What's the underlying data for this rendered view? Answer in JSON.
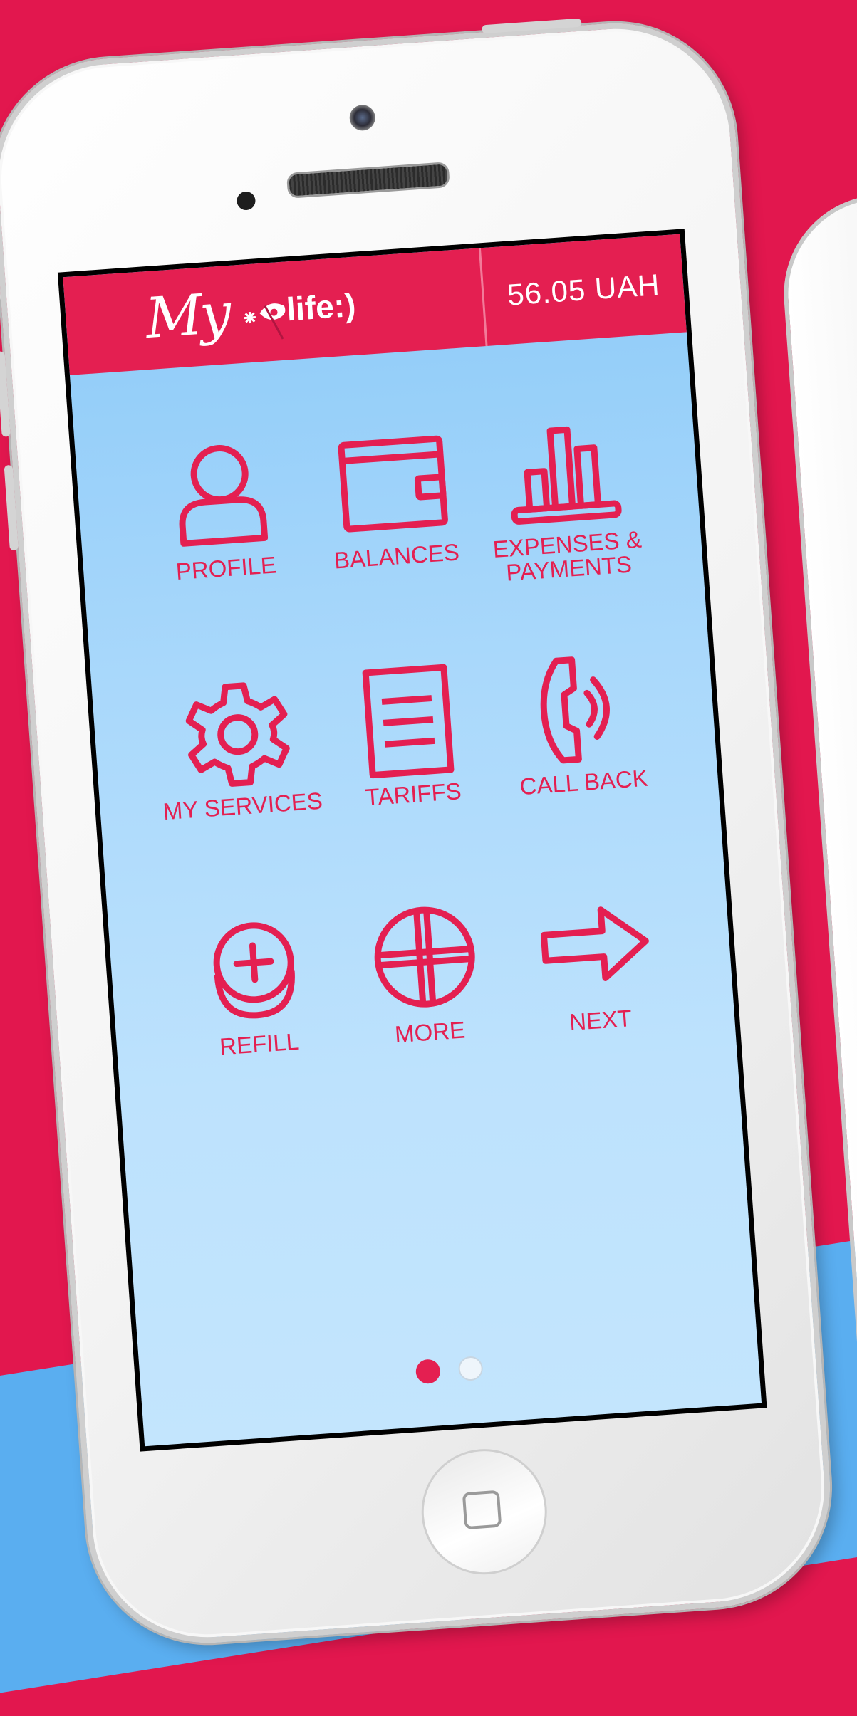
{
  "app": {
    "logo_prefix": "My",
    "logo_brand": "life:)",
    "balance": "56.05 UAH"
  },
  "menu": {
    "profile": "PROFILE",
    "balances": "BALANCES",
    "expenses": "EXPENSES &\nPAYMENTS",
    "services": "MY SERVICES",
    "tariffs": "TARIFFS",
    "callback": "CALL BACK",
    "refill": "REFILL",
    "more": "MORE",
    "next": "NEXT"
  },
  "pagination": {
    "current_page": 1,
    "total_pages": 2
  },
  "colors": {
    "brand": "#e41f51",
    "background": "#e2174e",
    "screen_top": "#8ecbf8",
    "screen_bottom": "#c3e5fd"
  }
}
